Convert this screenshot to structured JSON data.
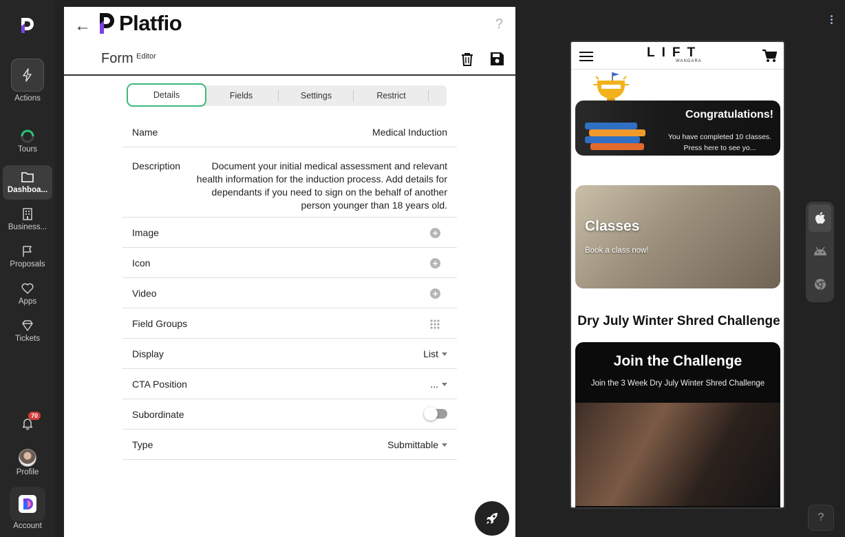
{
  "rail": {
    "items": [
      {
        "label": "Actions"
      },
      {
        "label": "Tours"
      },
      {
        "label": "Dashboa..."
      },
      {
        "label": "Business..."
      },
      {
        "label": "Proposals"
      },
      {
        "label": "Apps"
      },
      {
        "label": "Tickets"
      }
    ],
    "notifications_count": "70",
    "profile_label": "Profile",
    "account_label": "Account"
  },
  "header": {
    "brand": "Platfio",
    "help": "?",
    "form_title": "Form",
    "form_subtitle": "Editor"
  },
  "tabs": [
    {
      "label": "Details",
      "active": true
    },
    {
      "label": "Fields"
    },
    {
      "label": "Settings"
    },
    {
      "label": "Restrict"
    }
  ],
  "fields": {
    "name": {
      "label": "Name",
      "value": "Medical Induction"
    },
    "description": {
      "label": "Description",
      "value": "Document your initial medical assessment and relevant health information for the induction process. Add details for dependants if you need to sign on the behalf of another person younger than 18 years old."
    },
    "image": {
      "label": "Image"
    },
    "icon": {
      "label": "Icon"
    },
    "video": {
      "label": "Video"
    },
    "field_groups": {
      "label": "Field Groups"
    },
    "display": {
      "label": "Display",
      "value": "List"
    },
    "cta_position": {
      "label": "CTA Position",
      "value": "..."
    },
    "subordinate": {
      "label": "Subordinate",
      "enabled": false
    },
    "type": {
      "label": "Type",
      "value": "Submittable"
    }
  },
  "preview": {
    "logo": "LIFT",
    "logo_sub": "WANGARA",
    "congrats_title": "Congratulations!",
    "congrats_text": "You have completed 10 classes. Press here to see yo...",
    "classes_title": "Classes",
    "classes_text": "Book a class now!",
    "challenge_heading": "Dry July Winter Shred Challenge",
    "join_title": "Join the Challenge",
    "join_text": "Join the 3 Week Dry July Winter Shred Challenge"
  },
  "help_button": "?",
  "colors": {
    "accent": "#3db87a",
    "brand_purple": "#7b3fe4",
    "brand_blue": "#2f6bff"
  }
}
